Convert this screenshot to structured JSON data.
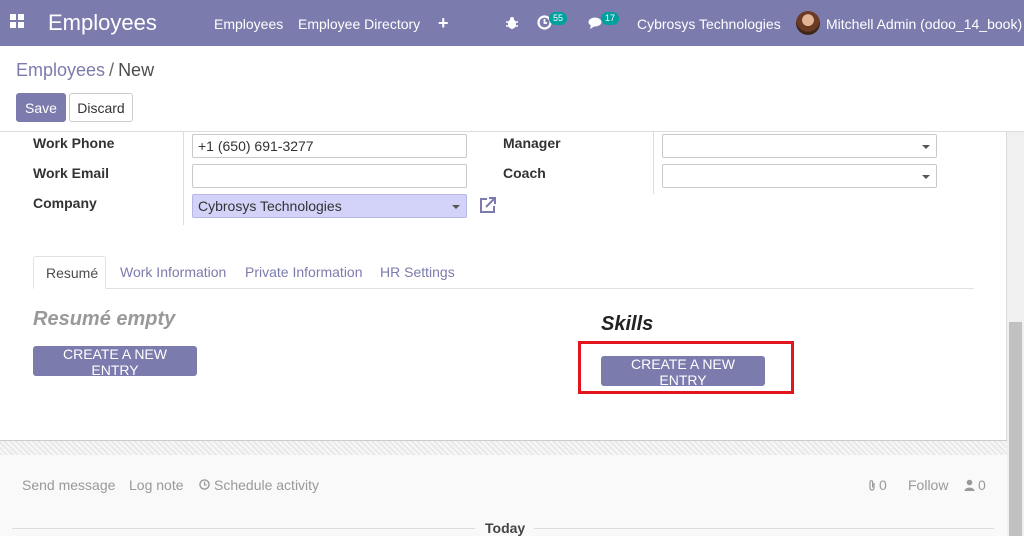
{
  "navbar": {
    "app_title": "Employees",
    "menus": [
      "Employees",
      "Employee Directory"
    ],
    "activity_count": "55",
    "message_count": "17",
    "company": "Cybrosys Technologies",
    "user": "Mitchell Admin (odoo_14_book)",
    "color": "#7c7bad"
  },
  "breadcrumb": {
    "parent": "Employees",
    "separator": "/",
    "current": "New"
  },
  "buttons": {
    "save": "Save",
    "discard": "Discard"
  },
  "form": {
    "work_phone_label": "Work Phone",
    "work_phone": "+1 (650) 691-3277",
    "work_email_label": "Work Email",
    "work_email": "",
    "company_label": "Company",
    "company": "Cybrosys Technologies",
    "manager_label": "Manager",
    "manager": "",
    "coach_label": "Coach",
    "coach": ""
  },
  "tabs": [
    "Resumé",
    "Work Information",
    "Private Information",
    "HR Settings"
  ],
  "resume": {
    "empty_text": "Resumé empty",
    "create_label": "CREATE A NEW ENTRY"
  },
  "skills": {
    "title": "Skills",
    "create_label": "CREATE A NEW ENTRY",
    "highlight_color": "#e2141c"
  },
  "chatter": {
    "send_message": "Send message",
    "log_note": "Log note",
    "schedule_activity": "Schedule activity",
    "attachments": "0",
    "follow": "Follow",
    "followers": "0",
    "today": "Today"
  }
}
